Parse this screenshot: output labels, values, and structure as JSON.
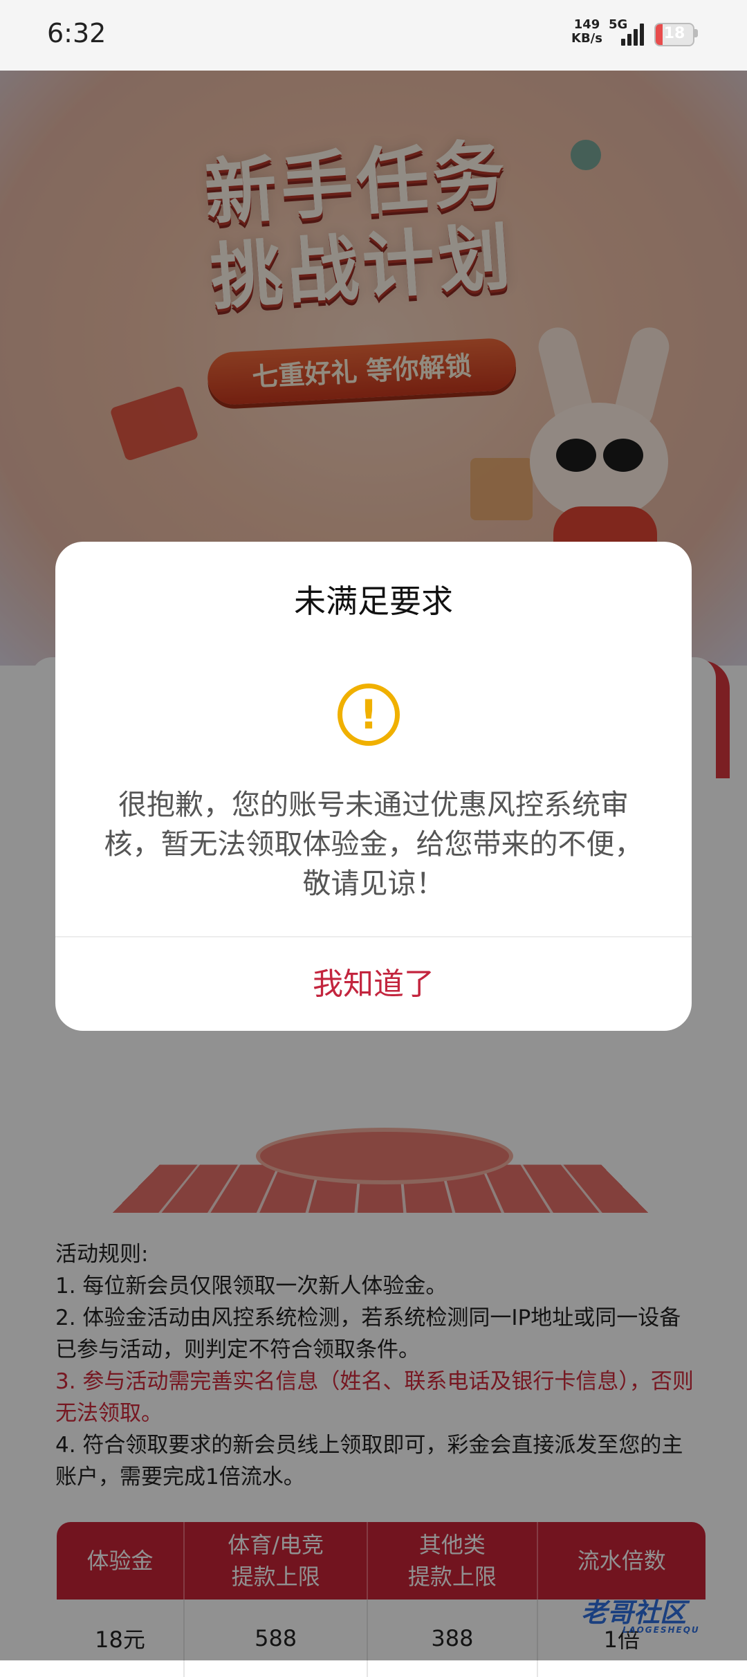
{
  "status_bar": {
    "time": "6:32",
    "net_speed": "149",
    "net_unit": "KB/s",
    "network_type": "5G",
    "signal_icon": "signal-bars-icon",
    "battery": "18"
  },
  "hero": {
    "title": "新手任务挑战计划",
    "subtitle": "七重好礼 等你解锁"
  },
  "dialog": {
    "title": "未满足要求",
    "icon": "warning-icon",
    "message": "很抱歉，您的账号未通过优惠风控系统审核，暂无法领取体验金，给您带来的不便，敬请见谅！",
    "confirm_label": "我知道了"
  },
  "rules": {
    "heading": "活动规则:",
    "items": [
      "1. 每位新会员仅限领取一次新人体验金。",
      "2. 体验金活动由风控系统检测，若系统检测同一IP地址或同一设备已参与活动，则判定不符合领取条件。",
      "3. 参与活动需完善实名信息（姓名、联系电话及银行卡信息），否则无法领取。",
      "4. 符合领取要求的新会员线上领取即可，彩金会直接派发至您的主账户，需要完成1倍流水。"
    ]
  },
  "table": {
    "headers": [
      "体验金",
      "体育/电竞提款上限",
      "其他类提款上限",
      "流水倍数"
    ],
    "header_lines": [
      [
        "体验金"
      ],
      [
        "体育/电竞",
        "提款上限"
      ],
      [
        "其他类",
        "提款上限"
      ],
      [
        "流水倍数"
      ]
    ],
    "rows": [
      [
        "18元",
        "588",
        "388",
        "1倍"
      ]
    ]
  },
  "watermark": {
    "text": "老哥社区",
    "sub": "LAOGESHEQU"
  },
  "colors": {
    "accent": "#c3253e",
    "warning": "#f0b000",
    "table_header": "#c92438"
  }
}
